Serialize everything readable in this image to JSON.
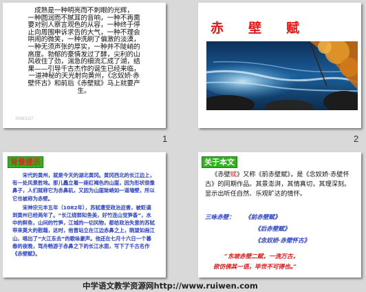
{
  "slide_numbers": [
    "1",
    "2"
  ],
  "slide1": {
    "poem_lines": [
      "成熟是一种明亮而不刺眼的光辉，",
      "一种圆润而不腻耳的音响，一种不再需",
      "要对别人察言观色的从容，一种终于停",
      "止向周围申诉求告的大气，一种不理会",
      "哄闹的微笑，一种洗刷了偏激的淡漠，",
      "一种无须声张的厚实，一种并不陡峭的",
      "高度。勃郁的豪情发过了酵，尖利的山",
      "风收住了劲，湍急的细流汇成了湖，结",
      "果——引导千古杰作的诞生已经来临，",
      "一道神秘的天光射向黄州，《念奴娇·赤",
      "壁怀古》和前后《赤壁赋》马上就要产",
      "生。"
    ],
    "date": "2008/12/7"
  },
  "slide2": {
    "title": "赤壁赋",
    "image_icon": "river-rocks-autumn-photo"
  },
  "slide3": {
    "tag": "背景提示",
    "paragraphs": [
      "宋代的黄州，就是今天的湖北黄冈。黄冈西北的长江边上，有一处风景胜地。那儿矗立着一座红褐色的山崖，因为形状很像鼻子，人们就称它为赤鼻矶，又因为山崖陡峭如一道墙壁，所以它也被称为赤壁。",
      "宋神宗元丰五年（1082年），苏轼遭受政治迫害，被贬谪到黄州已经两年了。“长江绕郭知鱼美，好竹连山觉笋香”，水中的鲜鱼，山间的竹笋，江城的一切风物，都给政治失意的苏轼带来莫大的慰藉，这时，他曾站立在江边赤鼻之上，眺望如画江山，唱出了“大江东去”的歌咏豪声。他还在七月十六日一个暮春的夜晚，驾舟畅游于赤鼻之下的长江水面，写下了千古名作《赤壁赋》。"
    ],
    "date": "2008/12/7"
  },
  "slide4": {
    "tag": "关于本文",
    "intro_part1": "《赤壁",
    "intro_red": "赋",
    "intro_part2": "》又称《前赤壁赋》，是《念奴娇·赤壁怀古》的同期作品。其景澎湃，其情真切，其理深刻。显示出听任自然、乐观旷达的情怀。",
    "works_label": "三咏赤壁：",
    "works": [
      "《前赤壁赋》",
      "《后赤壁赋》",
      "《念奴娇·赤壁怀古》"
    ],
    "quote_line1": "“东坡赤壁二赋，一洗万古，",
    "quote_line2": "欲仿佛其一语，毕世不可得也。”"
  },
  "footer": "中学语文教学资源网http://www.ruiwen.com",
  "colors": {
    "accent_red": "#e31414",
    "accent_green": "#2fb31e",
    "text_blue": "#2a40c4"
  }
}
